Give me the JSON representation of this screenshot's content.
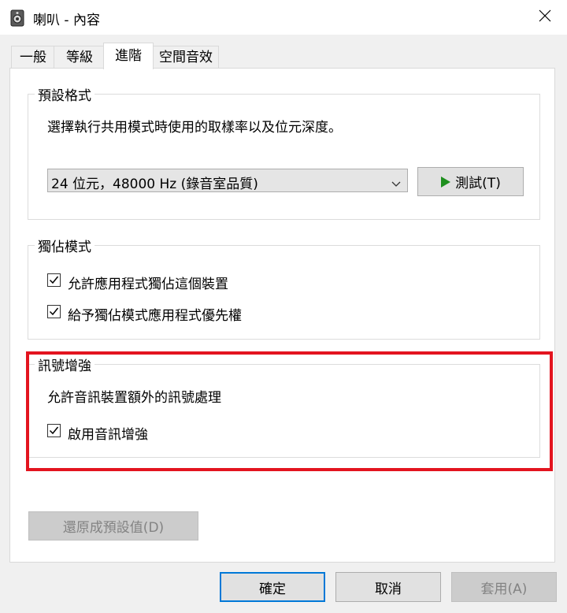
{
  "window": {
    "title": "喇叭 - 內容"
  },
  "tabs": [
    {
      "label": "一般"
    },
    {
      "label": "等級"
    },
    {
      "label": "進階"
    },
    {
      "label": "空間音效"
    }
  ],
  "default_format": {
    "legend": "預設格式",
    "description": "選擇執行共用模式時使用的取樣率以及位元深度。",
    "selected_format": "24 位元，48000 Hz (錄音室品質)",
    "test_button": "測試(T)"
  },
  "exclusive_mode": {
    "legend": "獨佔模式",
    "options": [
      {
        "label": "允許應用程式獨佔這個裝置",
        "checked": true
      },
      {
        "label": "給予獨佔模式應用程式優先權",
        "checked": true
      }
    ]
  },
  "signal_enhancements": {
    "legend": "訊號增強",
    "description": "允許音訊裝置額外的訊號處理",
    "option": {
      "label": "啟用音訊增強",
      "checked": true
    }
  },
  "restore_defaults_button": "還原成預設值(D)",
  "footer": {
    "ok": "確定",
    "cancel": "取消",
    "apply": "套用(A)"
  },
  "colors": {
    "highlight": "#e3141f",
    "play_icon": "#1e8f1e",
    "focus_border": "#0078d7"
  }
}
